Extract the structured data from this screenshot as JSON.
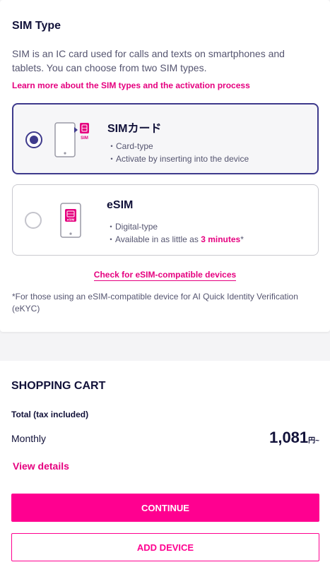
{
  "sim_section": {
    "title": "SIM Type",
    "description": "SIM is an IC card used for calls and texts on smartphones and tablets. You can choose from two SIM types.",
    "learn_more_link": "Learn more about the SIM types and the activation process",
    "options": [
      {
        "name": "SIMカード",
        "selected": true,
        "icon": "physical-sim-icon",
        "icon_label": "SIM",
        "bullets": [
          "Card-type",
          "Activate by inserting into the device"
        ]
      },
      {
        "name": "eSIM",
        "selected": false,
        "icon": "esim-icon",
        "icon_label": "eSIM",
        "bullets": [
          "Digital-type"
        ],
        "bullet2_prefix": "Available in as little as ",
        "bullet2_emphasis": "3 minutes",
        "bullet2_suffix": "*"
      }
    ],
    "check_link": "Check for eSIM-compatible devices",
    "note": "*For those using an eSIM-compatible device for AI Quick Identity Verification (eKYC)"
  },
  "cart": {
    "title": "SHOPPING CART",
    "total_label": "Total (tax included)",
    "monthly_label": "Monthly",
    "price": "1,081",
    "price_unit": "円~",
    "view_details": "View details",
    "continue_label": "CONTINUE",
    "add_device_label": "ADD DEVICE"
  },
  "colors": {
    "accent_pink": "#ff0090",
    "selected_border": "#3e3a8c",
    "text_dark": "#12123a"
  }
}
